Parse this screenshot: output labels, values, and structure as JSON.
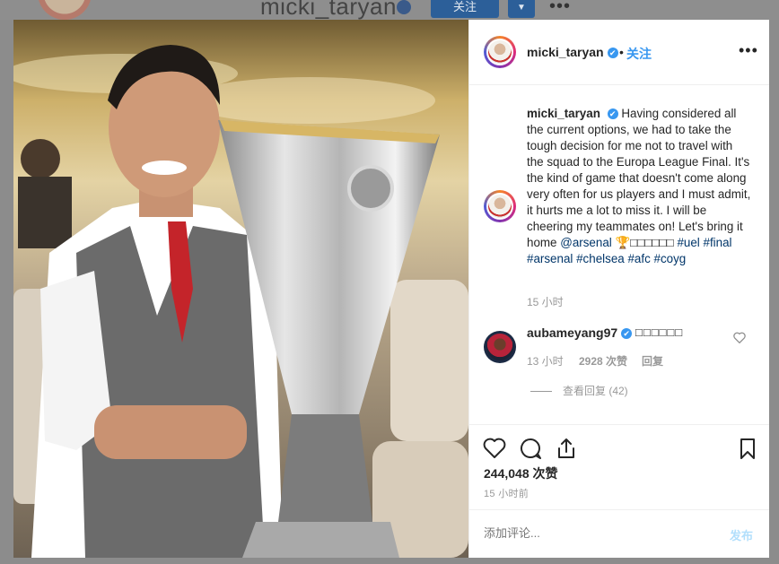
{
  "background": {
    "username": "micki_taryan",
    "follow_label": "关注",
    "more_label": "•••"
  },
  "header": {
    "username": "micki_taryan",
    "verified": "✔",
    "dot": "•",
    "follow_label": "关注",
    "more_label": "•••"
  },
  "caption": {
    "username": "micki_taryan",
    "text": "Having considered all the current options, we had to take the tough decision for me not to travel with the squad to the Europa League Final. It's the kind of game that doesn't come along very often for us players and I must admit, it hurts me a lot to miss it. I will be cheering my teammates on! Let's bring it home",
    "tags": [
      "@arsenal",
      "🏆",
      "□□□□□□",
      "#uel",
      "#final",
      "#arsenal",
      "#chelsea",
      "#afc",
      "#coyg"
    ],
    "time": "15 小时"
  },
  "comment": {
    "username": "aubameyang97",
    "text": "□□□□□□",
    "time": "13 小时",
    "likes": "2928 次赞",
    "reply_label": "回复",
    "view_replies": "查看回复 (42)"
  },
  "actions": {
    "likes": "244,048 次赞",
    "post_time": "15 小时前",
    "comment_placeholder": "添加评论...",
    "post_label": "发布"
  },
  "colors": {
    "accent": "#3897f0",
    "text": "#262626",
    "muted": "#999999",
    "hashtag": "#003569"
  }
}
